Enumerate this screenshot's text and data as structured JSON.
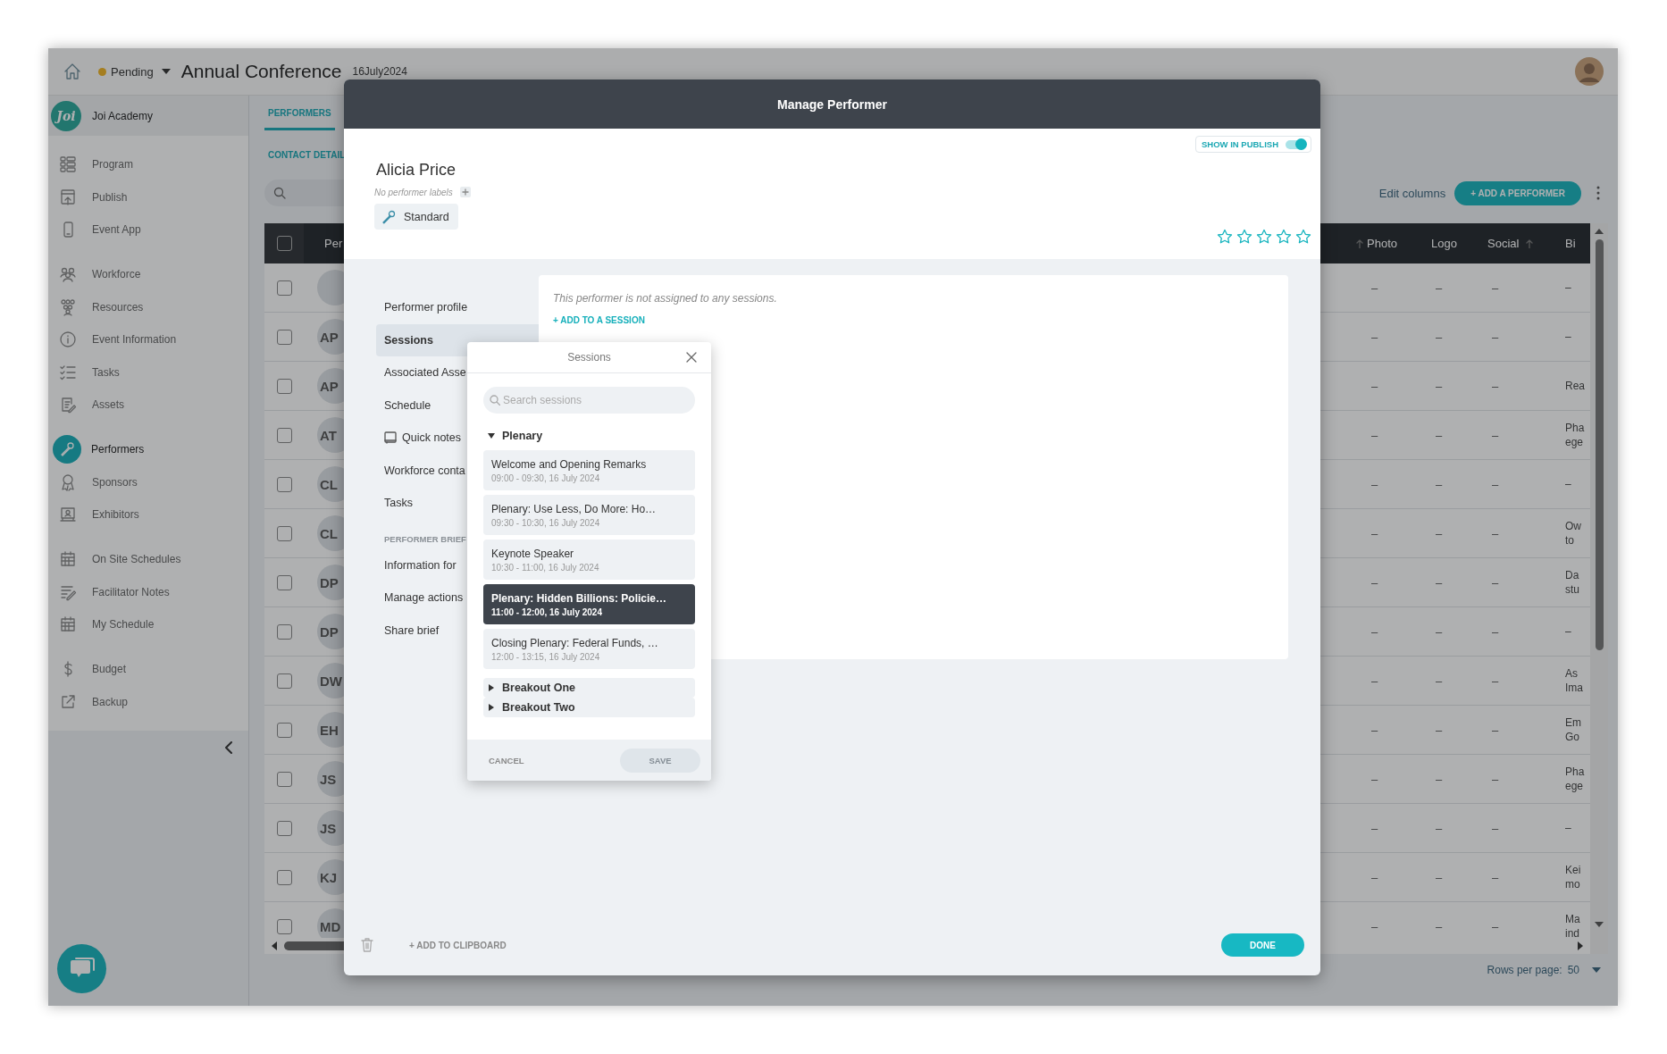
{
  "app_header": {
    "status": "Pending",
    "event_title": "Annual Conference",
    "event_date": "16July2024"
  },
  "sidebar": {
    "org": "Joi Academy",
    "logo_text": "Joi",
    "groups": [
      {
        "items": [
          {
            "label": "Program",
            "selected": false
          },
          {
            "label": "Publish",
            "selected": false
          },
          {
            "label": "Event App",
            "selected": false
          }
        ]
      },
      {
        "items": [
          {
            "label": "Workforce",
            "selected": false
          },
          {
            "label": "Resources",
            "selected": false
          },
          {
            "label": "Event Information",
            "selected": false
          },
          {
            "label": "Tasks",
            "selected": false
          },
          {
            "label": "Assets",
            "selected": false
          }
        ]
      },
      {
        "items": [
          {
            "label": "Performers",
            "selected": true
          },
          {
            "label": "Sponsors",
            "selected": false
          },
          {
            "label": "Exhibitors",
            "selected": false
          }
        ]
      },
      {
        "items": [
          {
            "label": "On Site Schedules",
            "selected": false
          },
          {
            "label": "Facilitator Notes",
            "selected": false
          },
          {
            "label": "My Schedule",
            "selected": false
          }
        ]
      },
      {
        "items": [
          {
            "label": "Budget",
            "selected": false
          },
          {
            "label": "Backup",
            "selected": false
          }
        ]
      }
    ]
  },
  "tabs": [
    {
      "label": "PERFORMERS",
      "selected": true
    }
  ],
  "section_link": "CONTACT DETAIL",
  "toolbar": {
    "edit_columns": "Edit columns",
    "add_button": "+ ADD A PERFORMER"
  },
  "table": {
    "select_all": {
      "checked": false
    },
    "columns": [
      {
        "kind": "text",
        "label": "Per"
      },
      {
        "kind": "sort"
      },
      {
        "kind": "text",
        "label": "Photo"
      },
      {
        "kind": "text",
        "label": "Logo"
      },
      {
        "kind": "text",
        "label": "Social",
        "sortable": true
      },
      {
        "kind": "text",
        "label": "Bi"
      }
    ],
    "rows": [
      {
        "checked": false,
        "photo": "–",
        "logo": "–",
        "social": "–",
        "bio": [
          "–"
        ]
      },
      {
        "checked": false,
        "initials": "AP",
        "photo": "–",
        "logo": "–",
        "social": "–",
        "bio": [
          "–"
        ]
      },
      {
        "checked": false,
        "initials": "AP",
        "photo": "–",
        "logo": "–",
        "social": "–",
        "bio": [
          "Rea"
        ]
      },
      {
        "checked": false,
        "initials": "AT",
        "photo": "–",
        "logo": "–",
        "social": "–",
        "bio": [
          "Pha",
          "ege"
        ]
      },
      {
        "checked": false,
        "initials": "CL",
        "photo": "–",
        "logo": "–",
        "social": "–",
        "bio": [
          "–"
        ]
      },
      {
        "checked": false,
        "initials": "CL",
        "photo": "–",
        "logo": "–",
        "social": "–",
        "bio": [
          "Ow",
          "to"
        ]
      },
      {
        "checked": false,
        "initials": "DP",
        "photo": "–",
        "logo": "–",
        "social": "–",
        "bio": [
          "Da",
          "stu"
        ]
      },
      {
        "checked": false,
        "initials": "DP",
        "photo": "–",
        "logo": "–",
        "social": "–",
        "bio": [
          "–"
        ]
      },
      {
        "checked": false,
        "initials": "DW",
        "photo": "–",
        "logo": "–",
        "social": "–",
        "bio": [
          "As",
          "Ima"
        ]
      },
      {
        "checked": false,
        "initials": "EH",
        "photo": "–",
        "logo": "–",
        "social": "–",
        "bio": [
          "Em",
          "Go"
        ]
      },
      {
        "checked": false,
        "initials": "JS",
        "photo": "–",
        "logo": "–",
        "social": "–",
        "bio": [
          "Pha",
          "ege"
        ]
      },
      {
        "checked": false,
        "initials": "JS",
        "photo": "–",
        "logo": "–",
        "social": "–",
        "bio": [
          "–"
        ]
      },
      {
        "checked": false,
        "initials": "KJ",
        "photo": "–",
        "logo": "–",
        "social": "–",
        "bio": [
          "Kei",
          "mo"
        ]
      },
      {
        "checked": false,
        "initials": "MD",
        "photo": "–",
        "logo": "–",
        "social": "–",
        "bio": [
          "Ma",
          "ind"
        ]
      }
    ]
  },
  "pagination": {
    "label": "Rows per page:",
    "value": "50"
  },
  "modal": {
    "title": "Manage Performer",
    "show_in_publish": {
      "label": "SHOW IN PUBLISH",
      "on": true
    },
    "performer": {
      "name": "Alicia Price",
      "labels_placeholder": "No performer labels",
      "tier": "Standard",
      "stars": 0
    },
    "nav": [
      {
        "kind": "link",
        "label": "Performer profile",
        "selected": false
      },
      {
        "kind": "link",
        "label": "Sessions",
        "selected": true
      },
      {
        "kind": "link",
        "label": "Associated Asse",
        "selected": false
      },
      {
        "kind": "link",
        "label": "Schedule",
        "selected": false
      },
      {
        "kind": "note",
        "label": "Quick notes",
        "selected": false
      },
      {
        "kind": "link",
        "label": "Workforce conta",
        "selected": false
      },
      {
        "kind": "link",
        "label": "Tasks",
        "selected": false
      },
      {
        "kind": "section",
        "label": "PERFORMER BRIEF"
      },
      {
        "kind": "link",
        "label": "Information for",
        "selected": false
      },
      {
        "kind": "link",
        "label": "Manage actions",
        "selected": false
      },
      {
        "kind": "link",
        "label": "Share brief",
        "selected": false
      }
    ],
    "content": {
      "empty_text": "This performer is not assigned to any sessions.",
      "add_link": "+ ADD TO A SESSION"
    },
    "footer": {
      "clipboard": "+ ADD TO CLIPBOARD",
      "done": "DONE"
    }
  },
  "sessions_popup": {
    "title": "Sessions",
    "search": {
      "placeholder": "Search sessions"
    },
    "groups": [
      {
        "name": "Plenary",
        "expanded": true,
        "sessions": [
          {
            "title": "Welcome and Opening Remarks",
            "time": "09:00 - 09:30, 16 July 2024",
            "selected": false
          },
          {
            "title": "Plenary: Use Less, Do More: Ho…",
            "time": "09:30 - 10:30, 16 July 2024",
            "selected": false
          },
          {
            "title": "Keynote Speaker",
            "time": "10:30 - 11:00, 16 July 2024",
            "selected": false
          },
          {
            "title": "Plenary: Hidden Billions: Policie…",
            "time": "11:00 - 12:00, 16 July 2024",
            "selected": true
          },
          {
            "title": "Closing Plenary: Federal Funds, …",
            "time": "12:00 - 13:15, 16 July 2024",
            "selected": false
          }
        ]
      },
      {
        "name": "Breakout One",
        "expanded": false
      },
      {
        "name": "Breakout Two",
        "expanded": false
      }
    ],
    "cancel": "CANCEL",
    "save": {
      "label": "SAVE",
      "disabled": true
    }
  }
}
